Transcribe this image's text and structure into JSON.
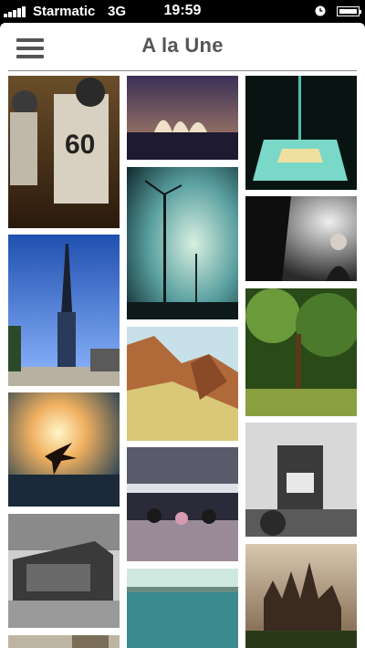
{
  "status_bar": {
    "carrier": "Starmatic",
    "network": "3G",
    "time": "19:59"
  },
  "header": {
    "title": "A la Une",
    "menu_icon": "hamburger-menu-icon"
  },
  "photos": [
    {
      "id": "football-players",
      "colors": [
        "#3a2a18",
        "#c9b9a0"
      ]
    },
    {
      "id": "opera-house",
      "colors": [
        "#2e2342",
        "#d8b98a"
      ]
    },
    {
      "id": "glowing-tiles",
      "colors": [
        "#0a1a14",
        "#8ff0e0"
      ]
    },
    {
      "id": "wind-turbine",
      "colors": [
        "#0d2a2a",
        "#9fd8c0"
      ]
    },
    {
      "id": "bw-portrait",
      "colors": [
        "#111111",
        "#dddddd"
      ]
    },
    {
      "id": "tower-spire",
      "colors": [
        "#1e4fa0",
        "#7fb0ff"
      ]
    },
    {
      "id": "red-cliffs",
      "colors": [
        "#7a4a2a",
        "#e6d08a"
      ]
    },
    {
      "id": "forest-garden",
      "colors": [
        "#1f3a12",
        "#7aa04a"
      ]
    },
    {
      "id": "seagull-sunset",
      "colors": [
        "#0f2a3a",
        "#ffe7a0"
      ]
    },
    {
      "id": "crowd-hall",
      "colors": [
        "#1a1a24",
        "#c8a0b8"
      ]
    },
    {
      "id": "living-room",
      "colors": [
        "#2a2a2a",
        "#e8e8e8"
      ]
    },
    {
      "id": "bw-building",
      "colors": [
        "#1a1a1a",
        "#d0d0d0"
      ]
    },
    {
      "id": "lake-view",
      "colors": [
        "#2a6a70",
        "#bfe3dc"
      ]
    },
    {
      "id": "castle",
      "colors": [
        "#2a2018",
        "#c9a888"
      ]
    },
    {
      "id": "partial-bottom",
      "colors": [
        "#7a7060",
        "#d8d0c0"
      ]
    }
  ]
}
